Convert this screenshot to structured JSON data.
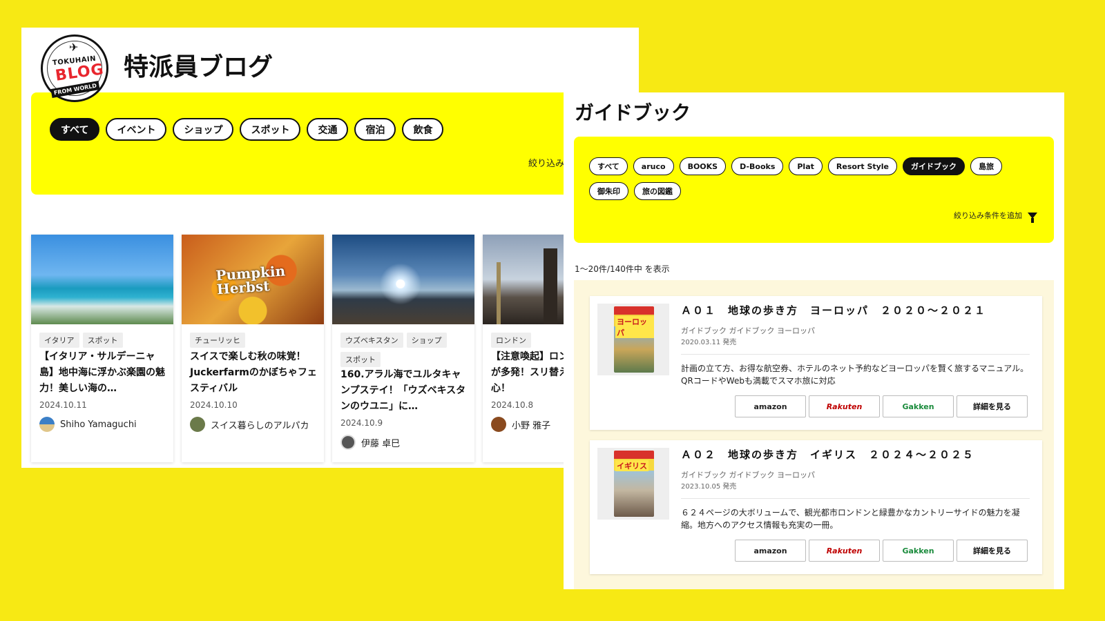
{
  "blog": {
    "logo": {
      "top_text": "TOKUHAIN",
      "main_text": "BLOG",
      "bottom_text": "FROM WORLD"
    },
    "title": "特派員ブログ",
    "filters": [
      {
        "label": "すべて",
        "active": true
      },
      {
        "label": "イベント"
      },
      {
        "label": "ショップ"
      },
      {
        "label": "スポット"
      },
      {
        "label": "交通"
      },
      {
        "label": "宿泊"
      },
      {
        "label": "飲食"
      }
    ],
    "more_filters_label": "絞り込み条件を",
    "articles": [
      {
        "tags": [
          "イタリア",
          "スポット"
        ],
        "title": "【イタリア・サルデーニャ島】地中海に浮かぶ楽園の魅力！美しい海の…",
        "date": "2024.10.11",
        "author": "Shiho Yamaguchi",
        "avatar_color": "#3b7fc7"
      },
      {
        "tags": [
          "チューリッヒ"
        ],
        "title": "スイスで楽しむ秋の味覚！Juckerfarmのかぼちゃフェスティバル",
        "date": "2024.10.10",
        "author": "スイス暮らしのアルパカ",
        "avatar_color": "#6b7a4a",
        "thumb_overlay": "Pumpkin Herbst"
      },
      {
        "tags": [
          "ウズベキスタン",
          "ショップ",
          "スポット"
        ],
        "title": "160.アラル海でユルタキャンプステイ！「ウズベキスタンのウユニ」に…",
        "date": "2024.10.9",
        "author": "伊藤 卓巳",
        "avatar_color": "#555555"
      },
      {
        "tags": [
          "ロンドン"
        ],
        "title": "【注意喚起】ロンドンでスリが多発！スリ替え盗難に用心！",
        "date": "2024.10.8",
        "author": "小野 雅子",
        "avatar_color": "#8a4a1f"
      }
    ]
  },
  "guide": {
    "title": "ガイドブック",
    "filters": [
      {
        "label": "すべて"
      },
      {
        "label": "aruco"
      },
      {
        "label": "BOOKS"
      },
      {
        "label": "D-Books"
      },
      {
        "label": "Plat"
      },
      {
        "label": "Resort Style"
      },
      {
        "label": "ガイドブック",
        "active": true
      },
      {
        "label": "島旅"
      },
      {
        "label": "御朱印"
      },
      {
        "label": "旅の図鑑"
      }
    ],
    "more_filters_label": "絞り込み条件を追加",
    "result_count": "1〜20件/140件中 を表示",
    "shop_buttons": {
      "amazon": "amazon",
      "rakuten": "Rakuten",
      "gakken": "Gakken",
      "detail": "詳細を見る"
    },
    "books": [
      {
        "title": "Ａ０１　地球の歩き方　ヨーロッパ　２０２０〜２０２１",
        "category": "ガイドブック ガイドブック ヨーロッパ",
        "release": "2020.03.11 発売",
        "description": "計画の立て方、お得な航空券、ホテルのネット予約などヨーロッパを賢く旅するマニュアル。QRコードやWebも満載でスマホ旅に対応",
        "cover_caption": "ヨーロッパ"
      },
      {
        "title": "Ａ０２　地球の歩き方　イギリス　２０２４〜２０２５",
        "category": "ガイドブック ガイドブック ヨーロッパ",
        "release": "2023.10.05 発売",
        "description": "６２４ページの大ボリュームで、観光都市ロンドンと緑豊かなカントリーサイドの魅力を凝縮。地方へのアクセス情報も充実の一冊。",
        "cover_caption": "イギリス"
      }
    ]
  },
  "colors": {
    "background": "#f7e914",
    "filter_panel": "#ffff00",
    "list_bg": "#fdf7dc",
    "rakuten": "#bf0000",
    "gakken": "#1a8b3c"
  }
}
